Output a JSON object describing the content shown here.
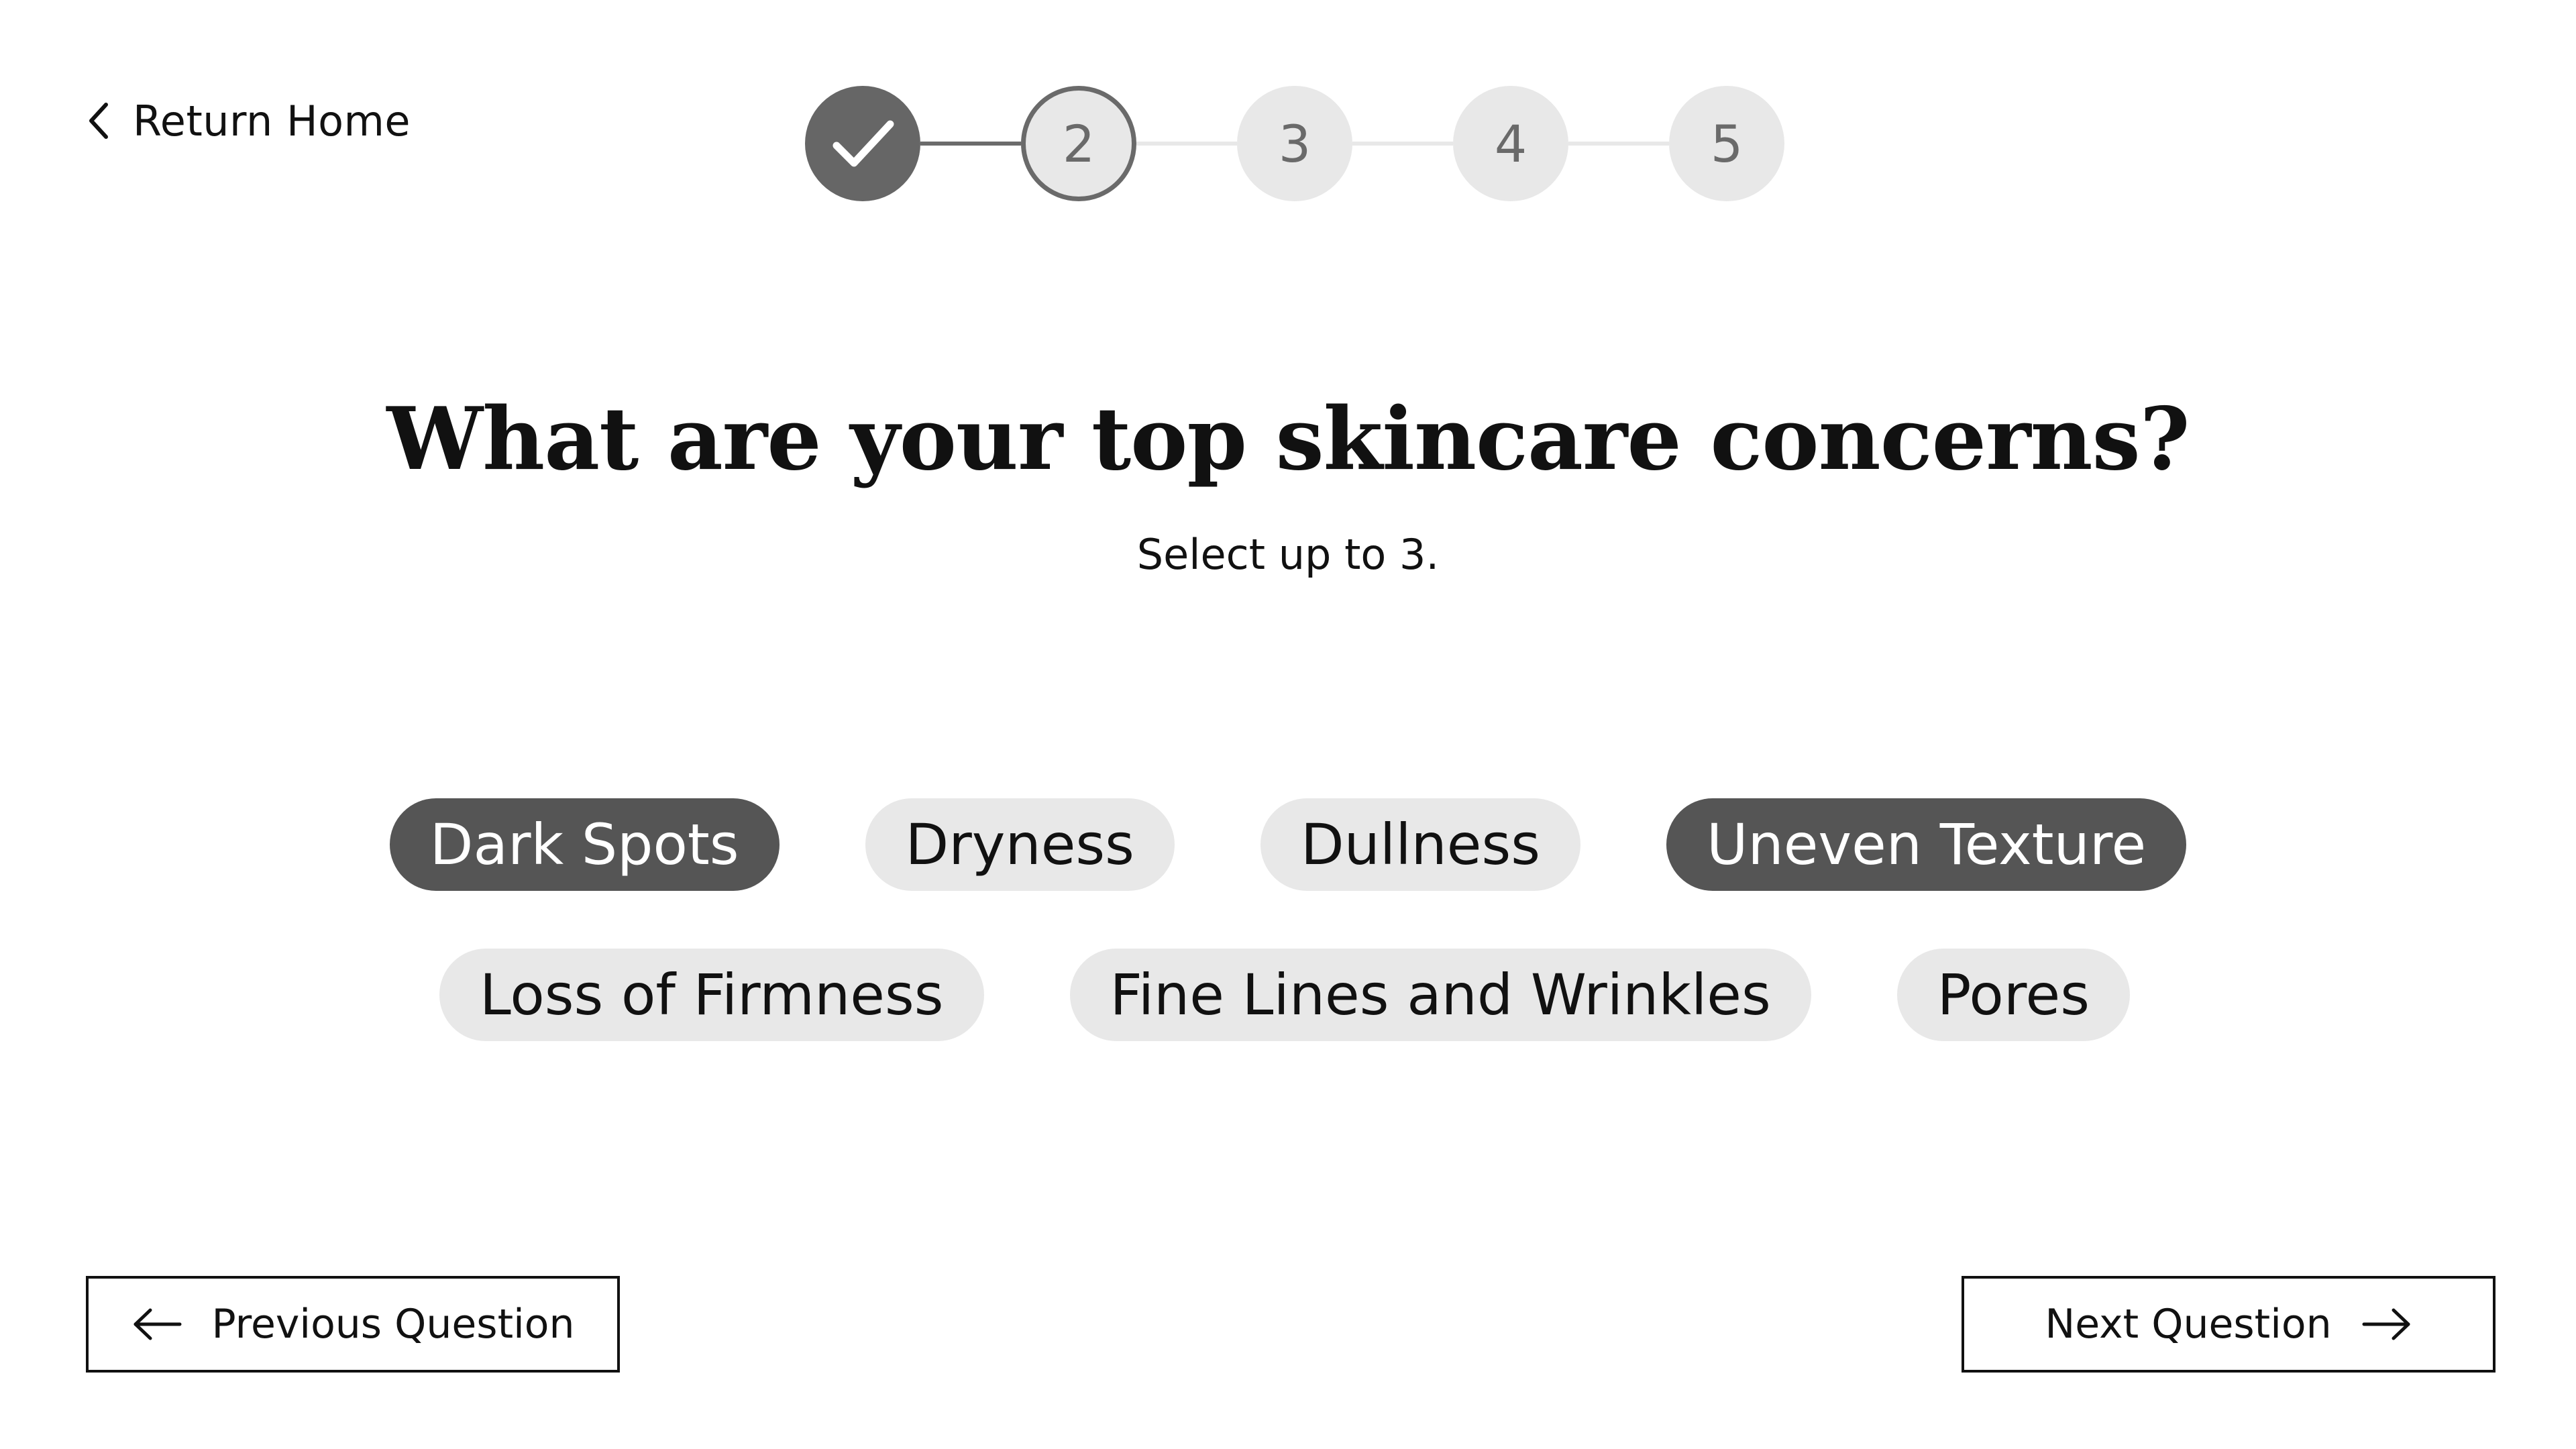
{
  "nav": {
    "return_home_label": "Return Home"
  },
  "stepper": {
    "current_step": 2,
    "total_steps": 5,
    "steps": [
      {
        "label": "",
        "state": "complete",
        "icon": "check-icon"
      },
      {
        "label": "2",
        "state": "current"
      },
      {
        "label": "3",
        "state": "upcoming"
      },
      {
        "label": "4",
        "state": "upcoming"
      },
      {
        "label": "5",
        "state": "upcoming"
      }
    ]
  },
  "question": {
    "title": "What are your top skincare concerns?",
    "subtitle": "Select up to 3."
  },
  "options": [
    {
      "label": "Dark Spots",
      "selected": true
    },
    {
      "label": "Dryness",
      "selected": false
    },
    {
      "label": "Dullness",
      "selected": false
    },
    {
      "label": "Uneven Texture",
      "selected": true
    },
    {
      "label": "Loss of Firmness",
      "selected": false
    },
    {
      "label": "Fine Lines and Wrinkles",
      "selected": false
    },
    {
      "label": "Pores",
      "selected": false
    }
  ],
  "footer": {
    "previous_label": "Previous Question",
    "next_label": "Next Question"
  },
  "colors": {
    "selected_chip": "#555555",
    "unselected_chip": "#e8e8e8",
    "step_complete": "#666666",
    "step_upcoming": "#e8e8e8"
  }
}
